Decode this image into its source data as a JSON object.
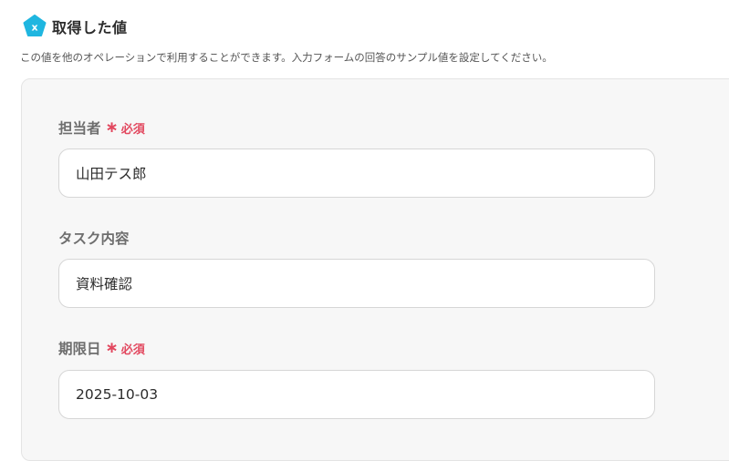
{
  "header": {
    "icon": "variable-x-icon",
    "title": "取得した値",
    "icon_color": "#1fb6e0"
  },
  "description": "この値を他のオペレーションで利用することができます。入力フォームの回答のサンプル値を設定してください。",
  "required_label": "必須",
  "required_color": "#e2485f",
  "fields": [
    {
      "label": "担当者",
      "required": true,
      "value": "山田テス郎"
    },
    {
      "label": "タスク内容",
      "required": false,
      "value": "資料確認"
    },
    {
      "label": "期限日",
      "required": true,
      "value": "2025-10-03"
    }
  ]
}
